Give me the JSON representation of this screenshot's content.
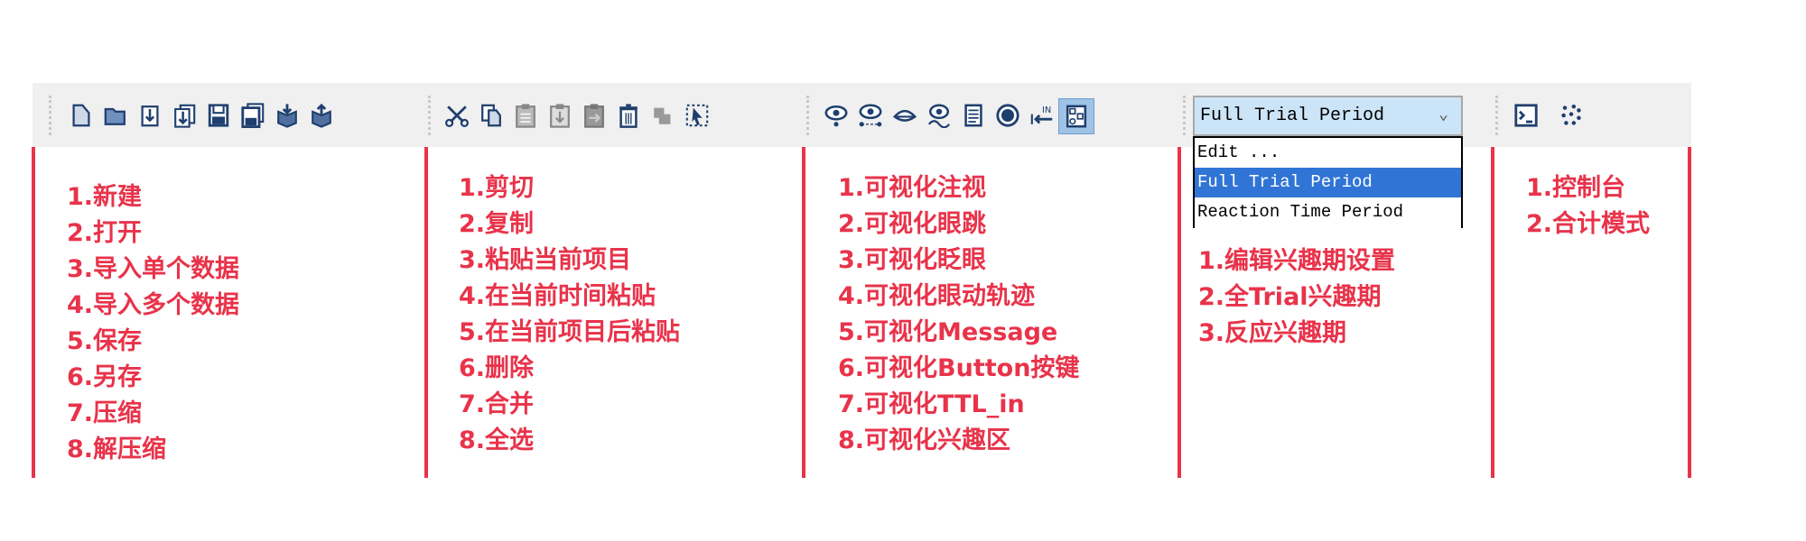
{
  "toolbar": {
    "file_icons": [
      "new-file-icon",
      "open-folder-icon",
      "import-single-icon",
      "import-multiple-icon",
      "save-icon",
      "save-as-icon",
      "compress-icon",
      "decompress-icon"
    ],
    "edit_icons": [
      "cut-icon",
      "copy-icon",
      "paste-icon",
      "paste-at-time-icon",
      "paste-after-icon",
      "delete-icon",
      "merge-icon",
      "select-all-icon"
    ],
    "view_icons": [
      "fixation-icon",
      "saccade-icon",
      "blink-icon",
      "eye-trace-icon",
      "message-icon",
      "button-icon",
      "ttl-in-icon",
      "interest-area-icon"
    ],
    "period_combo": {
      "value": "Full Trial Period",
      "options": [
        "Edit ...",
        "Full Trial Period",
        "Reaction Time Period"
      ],
      "selected_index": 1
    },
    "misc_icons": [
      "console-icon",
      "aggregate-mode-icon"
    ],
    "ttl_label": "IN"
  },
  "annotations": {
    "file": [
      "1.新建",
      "2.打开",
      "3.导入单个数据",
      "4.导入多个数据",
      "5.保存",
      "6.另存",
      "7.压缩",
      "8.解压缩"
    ],
    "edit": [
      "1.剪切",
      "2.复制",
      "3.粘贴当前项目",
      "4.在当前时间粘贴",
      "5.在当前项目后粘贴",
      "6.删除",
      "7.合并",
      "8.全选"
    ],
    "view": [
      "1.可视化注视",
      "2.可视化眼跳",
      "3.可视化眨眼",
      "4.可视化眼动轨迹",
      "5.可视化Message",
      "6.可视化Button按键",
      "7.可视化TTL_in",
      "8.可视化兴趣区"
    ],
    "period": [
      "1.编辑兴趣期设置",
      "2.全Trial兴趣期",
      "3.反应兴趣期"
    ],
    "misc": [
      "1.控制台",
      "2.合计模式"
    ]
  },
  "colors": {
    "annotation": "#e8334a",
    "icon": "#1f3f6e",
    "highlight": "#3075d6"
  }
}
